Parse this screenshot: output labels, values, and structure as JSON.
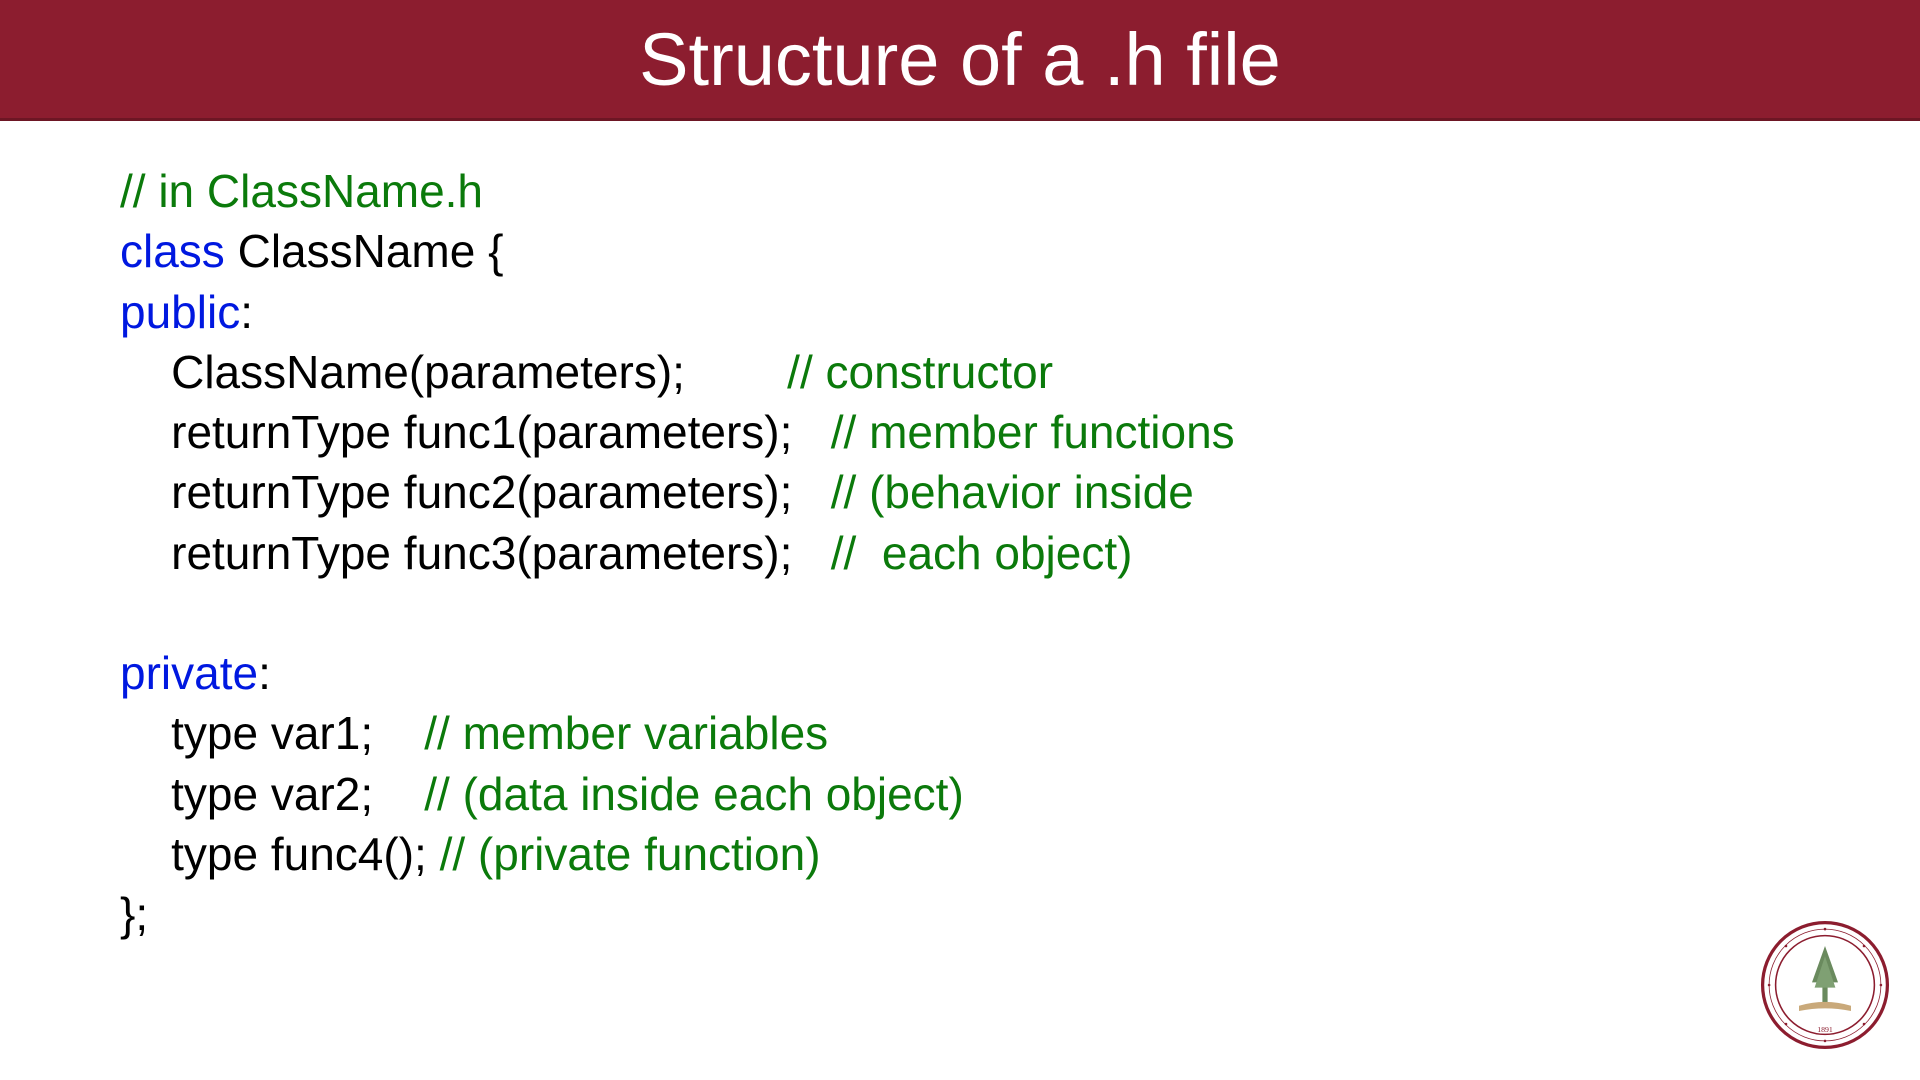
{
  "title": "Structure of a .h file",
  "code": {
    "line1_cmt": "// in ClassName.h",
    "line2_kw": "class",
    "line2_rest": " ClassName {",
    "line3_kw": "public",
    "line3_rest": ":",
    "line4_code": "    ClassName(parameters);        ",
    "line4_cmt": "// constructor",
    "line5_code": "    returnType func1(parameters);   ",
    "line5_cmt": "// member functions",
    "line6_code": "    returnType func2(parameters);   ",
    "line6_cmt": "// (behavior inside",
    "line7_code": "    returnType func3(parameters);   ",
    "line7_cmt": "//  each object)",
    "blank": "",
    "line9_kw": "private",
    "line9_rest": ":",
    "line10_code": "    type var1;    ",
    "line10_cmt": "// member variables",
    "line11_code": "    type var2;    ",
    "line11_cmt": "// (data inside each object)",
    "line12_code": "    type func4(); ",
    "line12_cmt": "// (private function)",
    "line13": "};"
  },
  "logo_alt": "stanford-seal"
}
